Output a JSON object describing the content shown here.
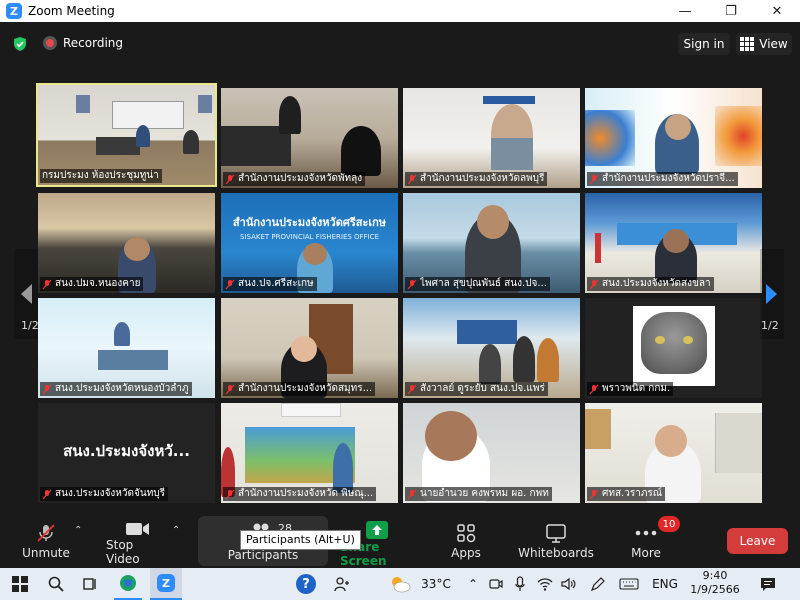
{
  "window": {
    "title": "Zoom Meeting",
    "minimize": "—",
    "maximize": "❐",
    "close": "✕"
  },
  "topbar": {
    "recording_label": "Recording",
    "signin_label": "Sign in",
    "view_label": "View"
  },
  "pagination": {
    "left": "1/2",
    "right": "1/2"
  },
  "participants": [
    {
      "name": "กรมประมง ห้องประชุมทูน่า"
    },
    {
      "name": "สำนักงานประมงจังหวัดพัทลุง"
    },
    {
      "name": "สำนักงานประมงจังหวัดลพบุรี"
    },
    {
      "name": "สำนักงานประมงจังหวัดปราจี..."
    },
    {
      "name": "สนง.ปมจ.หนองคาย"
    },
    {
      "name": "สนง.ปจ.ศรีสะเกษ",
      "sign": "สำนักงานประมงจังหวัดศรีสะเกษ",
      "sign_en": "SISAKET PROVINCIAL FISHERIES OFFICE"
    },
    {
      "name": "ไพศาล  สุขปุณพันธ์ สนง.ปจ..."
    },
    {
      "name": "สนง.ประมงจังหวัดสงขลา"
    },
    {
      "name": "สนง.ประมงจังหวัดหนองบัวลำภู"
    },
    {
      "name": "สำนักงานประมงจังหวัดสมุทร..."
    },
    {
      "name": "สังวาลย์ ดูระยับ สนง.ปจ.แพร่"
    },
    {
      "name": "พราวพนิต กกม."
    },
    {
      "name": "สนง.ประมงจังหวัดจันทบุรี",
      "big": "สนง.ประมงจังหวั..."
    },
    {
      "name": "สำนักงานประมงจังหวัด พิษณุ..."
    },
    {
      "name": "นายอำนวย คงพรหม ผอ. กพท"
    },
    {
      "name": "ศทส.วราภรณ์"
    }
  ],
  "toolbar": {
    "unmute": "Unmute",
    "stop_video": "Stop Video",
    "participants": "Participants",
    "participants_count": "28",
    "participants_tooltip": "Participants (Alt+U)",
    "share_screen": "Share Screen",
    "apps": "Apps",
    "whiteboards": "Whiteboards",
    "more": "More",
    "more_badge": "10",
    "leave": "Leave"
  },
  "taskbar": {
    "temperature": "33°C",
    "language": "ENG",
    "time": "9:40",
    "date": "1/9/2566"
  },
  "colors": {
    "accent": "#2D8CFF",
    "share": "#0E9F48",
    "leave": "#d43b3b",
    "active_border": "#e8e88a",
    "badge": "#e02828"
  }
}
